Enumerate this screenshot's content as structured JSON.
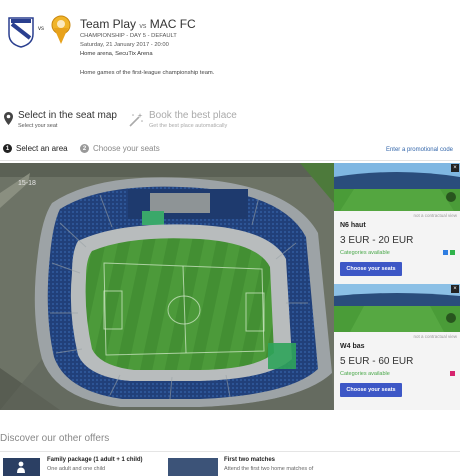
{
  "header": {
    "home_team": "Team Play",
    "vs_small": "vs",
    "away_team": "MAC FC",
    "vs_logo": "vs",
    "competition": "CHAMPIONSHIP - DAY 5 - DEFAULT",
    "datetime": "Saturday, 21 January 2017 - 20:00",
    "venue": "Home arena, SecuTix Arena",
    "description": "Home games of the first-league championship team."
  },
  "steps": [
    {
      "title": "Select in the seat map",
      "subtitle": "Select your seat",
      "icon": "map-pin-icon",
      "active": true
    },
    {
      "title": "Book the best place",
      "subtitle": "Get the best place automatically",
      "icon": "magic-wand-icon",
      "active": false
    }
  ],
  "subtabs": [
    {
      "number": "1",
      "label": "Select an area",
      "active": true
    },
    {
      "number": "2",
      "label": "Choose your seats",
      "active": false
    }
  ],
  "promo_link": "Enter a promotional code",
  "map": {
    "section_label": "15-18"
  },
  "areas": [
    {
      "name": "N6 haut",
      "price": "3 EUR - 20 EUR",
      "availability": "Categories available",
      "button": "Choose your seats",
      "note": "not a contractual view",
      "close": "×",
      "swatches": [
        "#2f7de1",
        "#2fb34a"
      ]
    },
    {
      "name": "W4 bas",
      "price": "5 EUR - 60 EUR",
      "availability": "Categories available",
      "button": "Choose your seats",
      "note": "not a contractual view",
      "close": "×",
      "swatches": [
        "#d6246e"
      ]
    }
  ],
  "offers": {
    "heading": "Discover our other offers",
    "items": [
      {
        "title": "Family package (1 adult + 1 child)",
        "subtitle": "One adult and one child"
      },
      {
        "title": "First two matches",
        "subtitle": "Attend the first two home matches of"
      }
    ]
  },
  "colors": {
    "accent_button": "#3d57c6",
    "available_green": "#4aa84a",
    "link_blue": "#3366aa"
  }
}
